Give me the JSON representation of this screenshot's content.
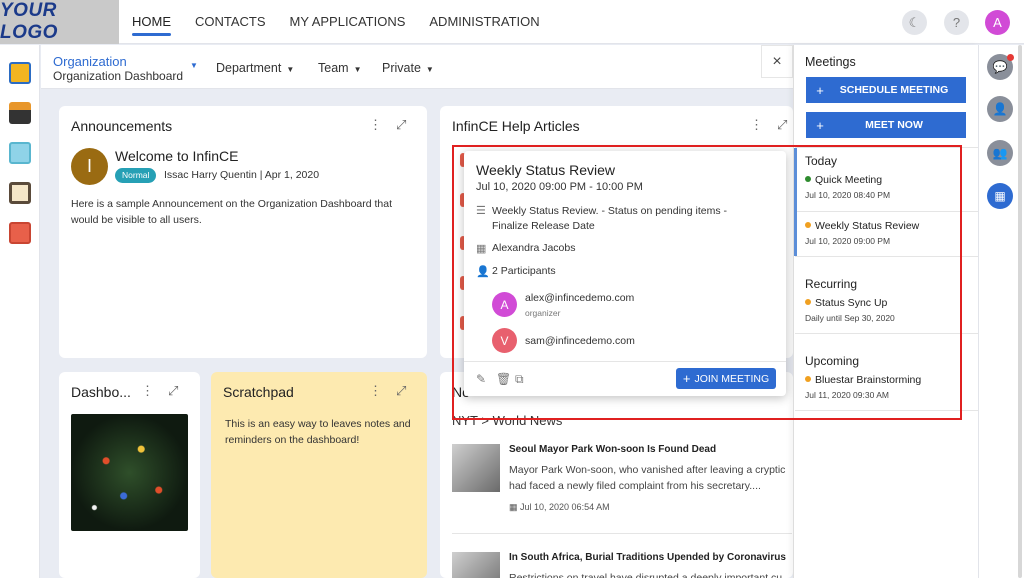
{
  "logo": "YOUR LOGO",
  "nav": [
    "HOME",
    "CONTACTS",
    "MY APPLICATIONS",
    "ADMINISTRATION"
  ],
  "user_initial": "A",
  "org": {
    "title": "Organization",
    "subtitle": "Organization Dashboard"
  },
  "filters": [
    "Department",
    "Team",
    "Private"
  ],
  "announcements": {
    "title": "Announcements",
    "avatar_initial": "I",
    "heading": "Welcome to InfinCE",
    "badge": "Normal",
    "meta": "Issac Harry Quentin | Apr 1, 2020",
    "body": "Here is a sample Announcement on the Organization Dashboard that would be visible to all users."
  },
  "help": {
    "title": "InfinCE Help Articles"
  },
  "dashboard_card": {
    "title": "Dashbo..."
  },
  "scratchpad": {
    "title": "Scratchpad",
    "body": "This is an easy way to leaves notes and reminders on the dashboard!"
  },
  "news": {
    "card_title_partial": "No",
    "section": "NYT > World News",
    "items": [
      {
        "title": "Seoul Mayor Park Won-soon Is Found Dead",
        "body": "Mayor Park Won-soon, who vanished after leaving a cryptic had faced a newly filed complaint from his secretary....",
        "date": "Jul 10, 2020 06:54 AM"
      },
      {
        "title": "In South Africa, Burial Traditions Upended by Coronavirus",
        "body": "Restrictions on travel have disrupted a deeply important cu",
        "date": ""
      }
    ]
  },
  "popup": {
    "title": "Weekly Status Review",
    "time": "Jul 10, 2020 09:00 PM - 10:00 PM",
    "description": "Weekly Status Review. - Status on pending items - Finalize Release Date",
    "organizer_name": "Alexandra Jacobs",
    "participants_label": "2 Participants",
    "participants": [
      {
        "initial": "A",
        "email": "alex@infincedemo.com",
        "role": "organizer",
        "color": "#d14bd6"
      },
      {
        "initial": "V",
        "email": "sam@infincedemo.com",
        "role": "",
        "color": "#e8606e"
      }
    ],
    "join_label": "JOIN MEETING"
  },
  "meetings": {
    "title": "Meetings",
    "close": "×",
    "schedule_label": "SCHEDULE MEETING",
    "meet_now_label": "MEET NOW",
    "sections": [
      {
        "name": "Today",
        "items": [
          {
            "name": "Quick Meeting",
            "time": "Jul 10, 2020 08:40 PM",
            "color": "#2e8b2e"
          },
          {
            "name": "Weekly Status Review",
            "time": "Jul 10, 2020 09:00 PM",
            "color": "#f0a020"
          }
        ]
      },
      {
        "name": "Recurring",
        "items": [
          {
            "name": "Status Sync Up",
            "time": "Daily until Sep 30, 2020",
            "color": "#f0a020"
          }
        ]
      },
      {
        "name": "Upcoming",
        "items": [
          {
            "name": "Bluestar Brainstorming",
            "time": "Jul 11, 2020 09:30 AM",
            "color": "#f0a020"
          }
        ]
      }
    ]
  }
}
